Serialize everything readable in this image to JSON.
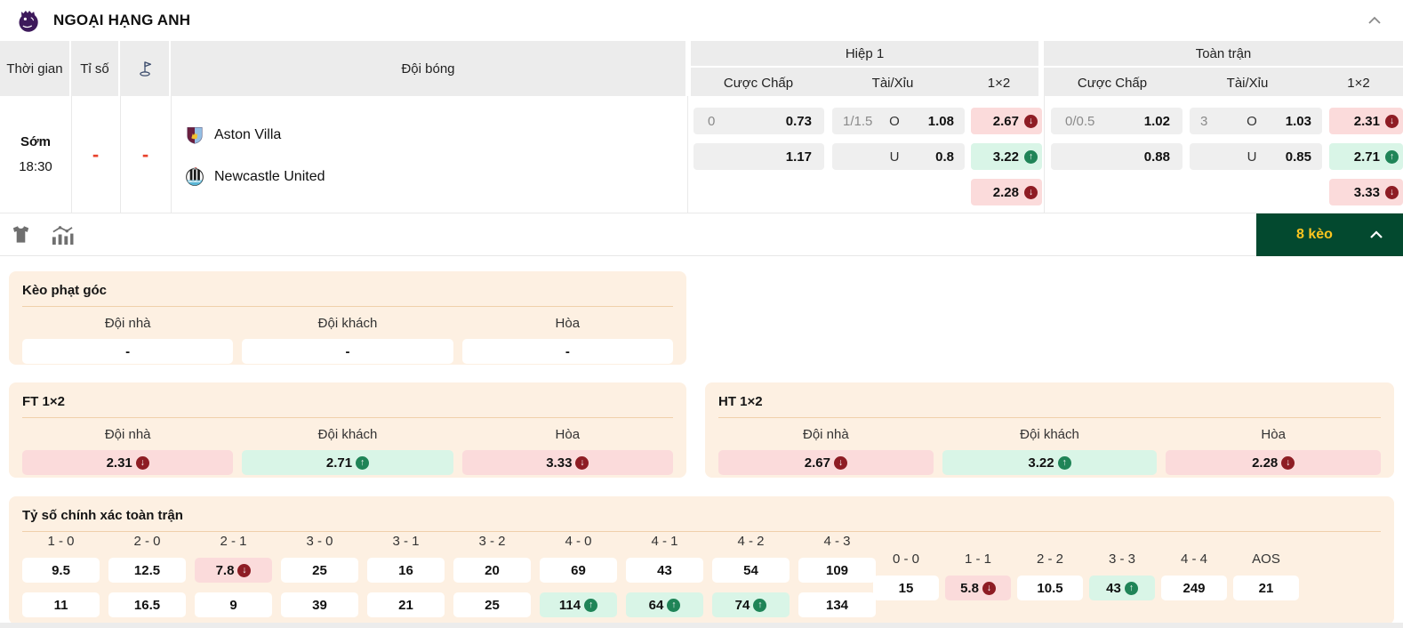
{
  "header": {
    "title": "NGOẠI HẠNG ANH"
  },
  "odds_table": {
    "columns": {
      "time": "Thời gian",
      "score": "Tỉ số",
      "team": "Đội bóng"
    },
    "groups": {
      "h1": "Hiệp 1",
      "ft": "Toàn trận"
    },
    "subcols": {
      "handicap": "Cược Chấp",
      "ou": "Tài/Xỉu",
      "x12": "1×2"
    }
  },
  "icons": {
    "league_logo": "premier-league-lion",
    "corner_column": "corner-flag",
    "toolbar": [
      "jersey",
      "stats-chart"
    ],
    "badge_chevron": "chevron-up",
    "header_chevron": "chevron-up"
  },
  "colors": {
    "badge_green": "#03492f",
    "badge_yellow": "#fdc51f",
    "odds_down_bg": "#fbdbdb",
    "odds_up_bg": "#d9f5e7",
    "down_circle": "#8e1c24",
    "up_circle": "#1f8457",
    "panel_bg": "#fdf0e2",
    "dash_red": "#e8432d"
  },
  "match": {
    "time_label": "Sớm",
    "time": "18:30",
    "score": "-",
    "corner": "-",
    "home_team": "Aston Villa",
    "away_team": "Newcastle United",
    "h1": {
      "hc_line": "0",
      "hc_home": "0.73",
      "hc_away": "1.17",
      "ou_line": "1/1.5",
      "o_label": "O",
      "ou_over": "1.08",
      "u_label": "U",
      "ou_under": "0.8",
      "x12": {
        "home": {
          "v": "2.67",
          "t": "down"
        },
        "away": {
          "v": "3.22",
          "t": "up"
        },
        "draw": {
          "v": "2.28",
          "t": "down"
        }
      }
    },
    "ft": {
      "hc_line": "0/0.5",
      "hc_home": "1.02",
      "hc_away": "0.88",
      "ou_line": "3",
      "o_label": "O",
      "ou_over": "1.03",
      "u_label": "U",
      "ou_under": "0.85",
      "x12": {
        "home": {
          "v": "2.31",
          "t": "down"
        },
        "away": {
          "v": "2.71",
          "t": "up"
        },
        "draw": {
          "v": "3.33",
          "t": "down"
        }
      }
    }
  },
  "toolbar": {
    "bets_badge": "8 kèo"
  },
  "corner_panel": {
    "title": "Kèo phạt góc",
    "cols": [
      "Đội nhà",
      "Đội khách",
      "Hòa"
    ],
    "values": [
      "-",
      "-",
      "-"
    ]
  },
  "ft_1x2": {
    "title": "FT 1×2",
    "cols": [
      "Đội nhà",
      "Đội khách",
      "Hòa"
    ],
    "values": [
      {
        "v": "2.31",
        "t": "down"
      },
      {
        "v": "2.71",
        "t": "up"
      },
      {
        "v": "3.33",
        "t": "down"
      }
    ]
  },
  "ht_1x2": {
    "title": "HT 1×2",
    "cols": [
      "Đội nhà",
      "Đội khách",
      "Hòa"
    ],
    "values": [
      {
        "v": "2.67",
        "t": "down"
      },
      {
        "v": "3.22",
        "t": "up"
      },
      {
        "v": "2.28",
        "t": "down"
      }
    ]
  },
  "correct_score": {
    "title": "Tỷ số chính xác toàn trận",
    "columns": [
      {
        "label": "1 - 0",
        "top": {
          "v": "9.5"
        },
        "bottom": {
          "v": "11"
        }
      },
      {
        "label": "2 - 0",
        "top": {
          "v": "12.5"
        },
        "bottom": {
          "v": "16.5"
        }
      },
      {
        "label": "2 - 1",
        "top": {
          "v": "7.8",
          "t": "down"
        },
        "bottom": {
          "v": "9"
        }
      },
      {
        "label": "3 - 0",
        "top": {
          "v": "25"
        },
        "bottom": {
          "v": "39"
        }
      },
      {
        "label": "3 - 1",
        "top": {
          "v": "16"
        },
        "bottom": {
          "v": "21"
        }
      },
      {
        "label": "3 - 2",
        "top": {
          "v": "20"
        },
        "bottom": {
          "v": "25"
        }
      },
      {
        "label": "4 - 0",
        "top": {
          "v": "69"
        },
        "bottom": {
          "v": "114",
          "t": "up"
        }
      },
      {
        "label": "4 - 1",
        "top": {
          "v": "43"
        },
        "bottom": {
          "v": "64",
          "t": "up"
        }
      },
      {
        "label": "4 - 2",
        "top": {
          "v": "54"
        },
        "bottom": {
          "v": "74",
          "t": "up"
        }
      },
      {
        "label": "4 - 3",
        "top": {
          "v": "109"
        },
        "bottom": {
          "v": "134"
        }
      }
    ],
    "singles": [
      {
        "label": "0 - 0",
        "value": {
          "v": "15"
        }
      },
      {
        "label": "1 - 1",
        "value": {
          "v": "5.8",
          "t": "down"
        }
      },
      {
        "label": "2 - 2",
        "value": {
          "v": "10.5"
        }
      },
      {
        "label": "3 - 3",
        "value": {
          "v": "43",
          "t": "up"
        }
      },
      {
        "label": "4 - 4",
        "value": {
          "v": "249"
        }
      },
      {
        "label": "AOS",
        "value": {
          "v": "21"
        }
      }
    ]
  }
}
